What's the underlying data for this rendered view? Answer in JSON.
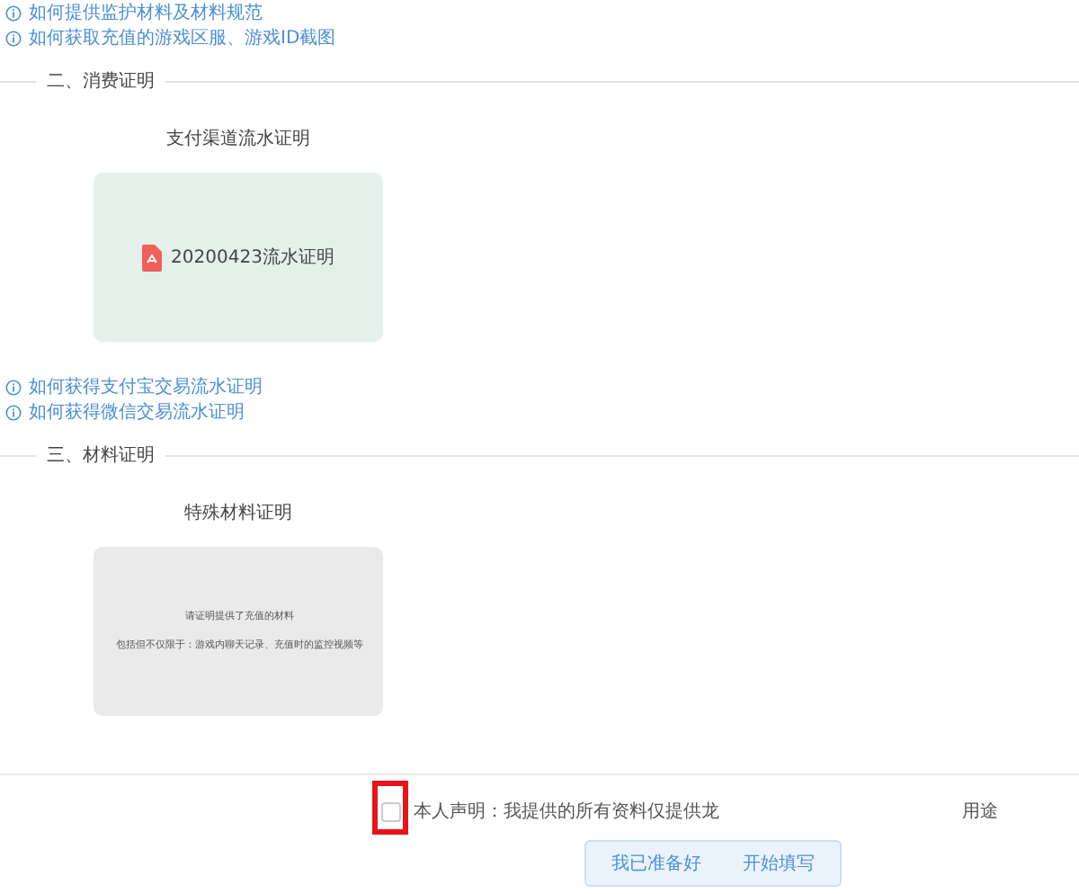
{
  "top_links": [
    "如何提供监护材料及材料规范",
    "如何获取充值的游戏区服、游戏ID截图"
  ],
  "sections": [
    {
      "title": "二、消费证明",
      "card_title": "支付渠道流水证明",
      "card": {
        "kind": "file",
        "file_name": "20200423流水证明"
      },
      "links": [
        "如何获得支付宝交易流水证明",
        "如何获得微信交易流水证明"
      ]
    },
    {
      "title": "三、材料证明",
      "card_title": "特殊材料证明",
      "card": {
        "kind": "note",
        "lines": [
          "请证明提供了充值的材料",
          "包括但不仅限于：游戏内聊天记录、充值时的监控视频等"
        ]
      }
    }
  ],
  "declaration": {
    "checked": false,
    "highlighted": true,
    "text_start": "本人声明：我提供的所有资料仅提供龙",
    "text_end": "用途"
  },
  "button": {
    "text_start": "我已准备好",
    "text_end": "开始填写"
  }
}
